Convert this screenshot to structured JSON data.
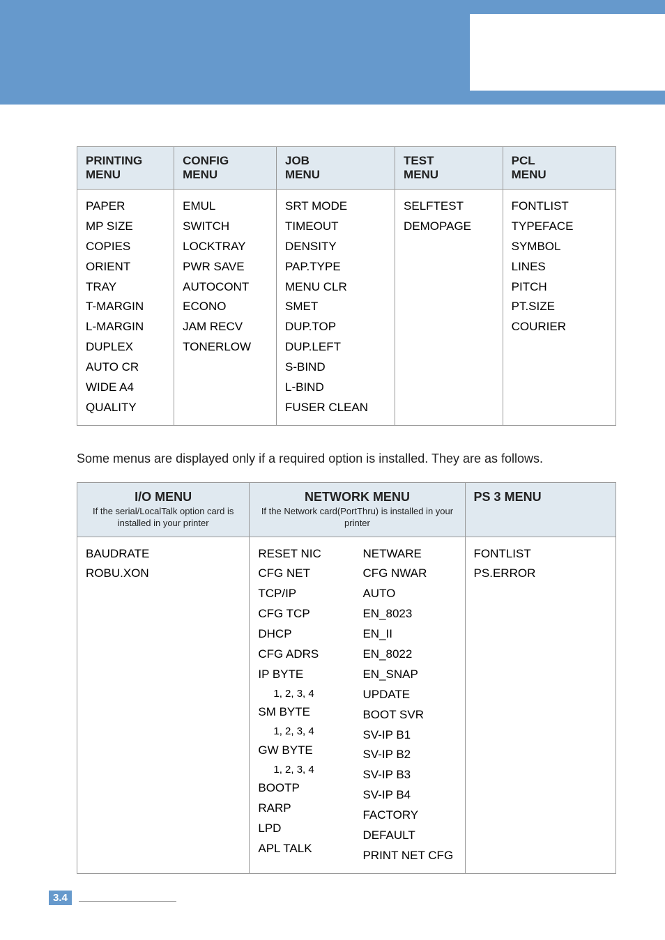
{
  "table1": {
    "headers": {
      "printing": {
        "title": "PRINTING",
        "sub": "MENU"
      },
      "config": {
        "title": "CONFIG",
        "sub": "MENU"
      },
      "job": {
        "title": "JOB",
        "sub": "MENU"
      },
      "test": {
        "title": "TEST",
        "sub": "MENU"
      },
      "pcl": {
        "title": "PCL",
        "sub": "MENU"
      }
    },
    "cols": {
      "printing": [
        "PAPER",
        "MP SIZE",
        "COPIES",
        "ORIENT",
        "TRAY",
        "T-MARGIN",
        "L-MARGIN",
        "DUPLEX",
        "AUTO CR",
        "WIDE A4",
        "QUALITY"
      ],
      "config": [
        "EMUL",
        "SWITCH",
        "LOCKTRAY",
        "PWR SAVE",
        "AUTOCONT",
        "ECONO",
        "JAM RECV",
        "TONERLOW"
      ],
      "job": [
        "SRT MODE",
        "TIMEOUT",
        "DENSITY",
        "PAP.TYPE",
        "MENU CLR",
        "SMET",
        "DUP.TOP",
        "DUP.LEFT",
        "S-BIND",
        "L-BIND",
        "FUSER CLEAN"
      ],
      "test": [
        "SELFTEST",
        "DEMOPAGE"
      ],
      "pcl": [
        "FONTLIST",
        "TYPEFACE",
        "SYMBOL",
        "LINES",
        "PITCH",
        "PT.SIZE",
        "COURIER"
      ]
    }
  },
  "intro": "Some menus are displayed only if a required option is installed.\nThey are as follows.",
  "table2": {
    "headers": {
      "io": {
        "title": "I/O MENU",
        "sub": "If the serial/LocalTalk option card is installed in your printer"
      },
      "net": {
        "title": "NETWORK MENU",
        "sub": "If the Network card(PortThru) is installed in your printer"
      },
      "ps3": {
        "title": "PS 3 MENU"
      }
    },
    "cols": {
      "io": [
        "BAUDRATE",
        "ROBU.XON"
      ],
      "net_left": [
        "RESET NIC",
        "CFG NET",
        "TCP/IP",
        "CFG TCP",
        "DHCP",
        "CFG ADRS",
        "IP BYTE",
        "  1, 2, 3, 4",
        "SM BYTE",
        "  1, 2, 3, 4",
        "GW BYTE",
        "  1, 2, 3, 4",
        "BOOTP",
        "RARP",
        "LPD",
        "APL TALK"
      ],
      "net_right": [
        "NETWARE",
        "CFG NWAR",
        "AUTO",
        "EN_8023",
        "EN_II",
        "EN_8022",
        "EN_SNAP",
        "UPDATE",
        "BOOT SVR",
        "SV-IP B1",
        "SV-IP B2",
        "SV-IP B3",
        "SV-IP B4",
        "FACTORY DEFAULT",
        "PRINT NET CFG"
      ],
      "ps3": [
        "FONTLIST",
        "PS.ERROR"
      ]
    }
  },
  "page": {
    "chapter": "3",
    "num": "4"
  }
}
